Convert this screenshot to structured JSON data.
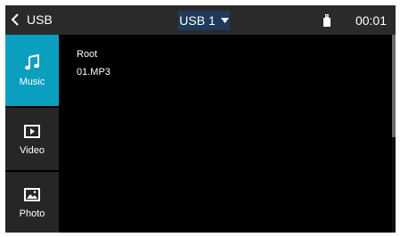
{
  "header": {
    "back_label": "USB",
    "source_selected": "USB 1",
    "clock": "00:01",
    "icons": {
      "back": "chevron-left-icon",
      "dropdown": "caret-down-icon",
      "usb": "usb-drive-icon"
    }
  },
  "sidebar": {
    "items": [
      {
        "label": "Music",
        "icon": "music-note-icon",
        "active": true
      },
      {
        "label": "Video",
        "icon": "video-icon",
        "active": false
      },
      {
        "label": "Photo",
        "icon": "photo-icon",
        "active": false
      }
    ]
  },
  "file_list": {
    "items": [
      "Root",
      "01.MP3"
    ]
  },
  "colors": {
    "accent": "#0a9fbf",
    "header_bg": "#2a2a2a",
    "sidebar_bg": "#262626",
    "select_bg": "#1f3a5a",
    "content_bg": "#000000"
  }
}
